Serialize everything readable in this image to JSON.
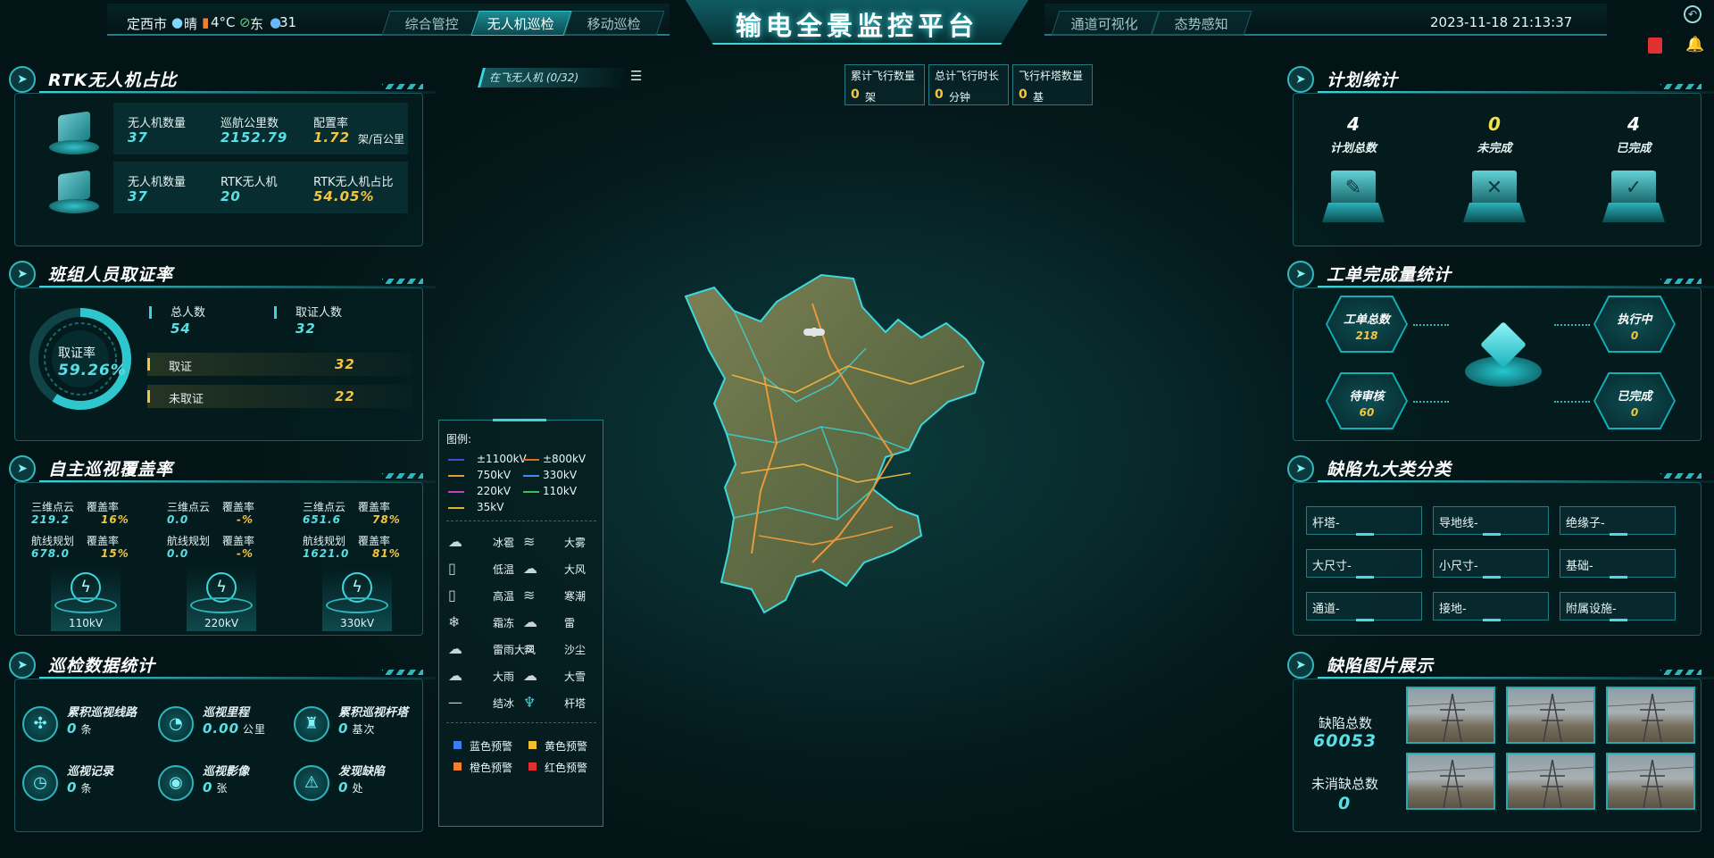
{
  "header": {
    "city": "定西市",
    "weather": "晴",
    "temperature": "4°C",
    "wind": "东",
    "humidity": "31",
    "title": "输电全景监控平台",
    "datetime": "2023-11-18 21:13:37",
    "left_tabs": [
      "综合管控",
      "无人机巡检",
      "移动巡检"
    ],
    "right_tabs": [
      "通道可视化",
      "态势感知"
    ],
    "active_tab": "无人机巡检"
  },
  "rtk": {
    "title": "RTK无人机占比",
    "row1": {
      "l1": "无人机数量",
      "v1": "37",
      "l2": "巡航公里数",
      "v2": "2152.79",
      "l3": "配置率",
      "v3": "1.72",
      "u3": "架/百公里"
    },
    "row2": {
      "l1": "无人机数量",
      "v1": "37",
      "l2": "RTK无人机",
      "v2": "20",
      "l3": "RTK无人机占比",
      "v3": "54.05%"
    }
  },
  "cert": {
    "title": "班组人员取证率",
    "rate_label": "取证率",
    "rate": "59.26%",
    "rate_value": 0.5926,
    "total_label": "总人数",
    "total": "54",
    "certified_label": "取证人数",
    "certified": "32",
    "rows": [
      {
        "label": "取证",
        "value": "32"
      },
      {
        "label": "未取证",
        "value": "22"
      }
    ]
  },
  "coverage": {
    "title": "自主巡视覆盖率",
    "groups": [
      {
        "l1": "三维点云",
        "l2": "覆盖率",
        "v1": "219.2",
        "p1": "16%",
        "l3": "航线规划",
        "l4": "覆盖率",
        "v2": "678.0",
        "p2": "15%",
        "kv": "110kV"
      },
      {
        "l1": "三维点云",
        "l2": "覆盖率",
        "v1": "0.0",
        "p1": "-%",
        "l3": "航线规划",
        "l4": "覆盖率",
        "v2": "0.0",
        "p2": "-%",
        "kv": "220kV"
      },
      {
        "l1": "三维点云",
        "l2": "覆盖率",
        "v1": "651.6",
        "p1": "78%",
        "l3": "航线规划",
        "l4": "覆盖率",
        "v2": "1621.0",
        "p2": "81%",
        "kv": "330kV"
      }
    ]
  },
  "patrol": {
    "title": "巡检数据统计",
    "items": [
      {
        "label": "累积巡视线路",
        "value": "0",
        "unit": "条"
      },
      {
        "label": "巡视里程",
        "value": "0.00",
        "unit": "公里"
      },
      {
        "label": "累积巡视杆塔",
        "value": "0",
        "unit": "基次"
      },
      {
        "label": "巡视记录",
        "value": "0",
        "unit": "条"
      },
      {
        "label": "巡视影像",
        "value": "0",
        "unit": "张"
      },
      {
        "label": "发现缺陷",
        "value": "0",
        "unit": "处"
      }
    ]
  },
  "center": {
    "flying": "在飞无人机 (0/32)",
    "stats": [
      {
        "label": "累计飞行数量",
        "value": "0",
        "unit": "架"
      },
      {
        "label": "总计飞行时长",
        "value": "0",
        "unit": "分钟"
      },
      {
        "label": "飞行杆塔数量",
        "value": "0",
        "unit": "基"
      }
    ]
  },
  "legend": {
    "title": "图例:",
    "voltages": [
      {
        "label": "±1100kV",
        "color": "#4a4ad8"
      },
      {
        "label": "±800kV",
        "color": "#e07020"
      },
      {
        "label": "750kV",
        "color": "#e89a3a"
      },
      {
        "label": "330kV",
        "color": "#3a8ef0"
      },
      {
        "label": "220kV",
        "color": "#c040c0"
      },
      {
        "label": "110kV",
        "color": "#38c060"
      },
      {
        "label": "35kV",
        "color": "#e0b030"
      }
    ],
    "weather": [
      "冰雹",
      "大雾",
      "低温",
      "大风",
      "高温",
      "寒潮",
      "霜冻",
      "雷",
      "雷雨大风",
      "沙尘",
      "大雨",
      "大雪",
      "结冰",
      "杆塔"
    ],
    "warnings": [
      {
        "label": "蓝色预警",
        "color": "#3a7ef0"
      },
      {
        "label": "黄色预警",
        "color": "#f0c030"
      },
      {
        "label": "橙色预警",
        "color": "#f08030"
      },
      {
        "label": "红色预警",
        "color": "#e03030"
      }
    ]
  },
  "plan": {
    "title": "计划统计",
    "items": [
      {
        "value": "4",
        "label": "计划总数",
        "icon": "edit-icon"
      },
      {
        "value": "0",
        "label": "未完成",
        "icon": "x-icon"
      },
      {
        "value": "4",
        "label": "已完成",
        "icon": "check-icon"
      }
    ]
  },
  "workorder": {
    "title": "工单完成量统计",
    "items": [
      {
        "label": "工单总数",
        "value": "218"
      },
      {
        "label": "执行中",
        "value": "0"
      },
      {
        "label": "待审核",
        "value": "60"
      },
      {
        "label": "已完成",
        "value": "0"
      }
    ]
  },
  "defect_cat": {
    "title": "缺陷九大类分类",
    "items": [
      "杆塔-",
      "导地线-",
      "绝缘子-",
      "大尺寸-",
      "小尺寸-",
      "基础-",
      "通道-",
      "接地-",
      "附属设施-"
    ]
  },
  "defect_img": {
    "title": "缺陷图片展示",
    "total_label": "缺陷总数",
    "total": "60053",
    "pending_label": "未消缺总数",
    "pending": "0"
  }
}
